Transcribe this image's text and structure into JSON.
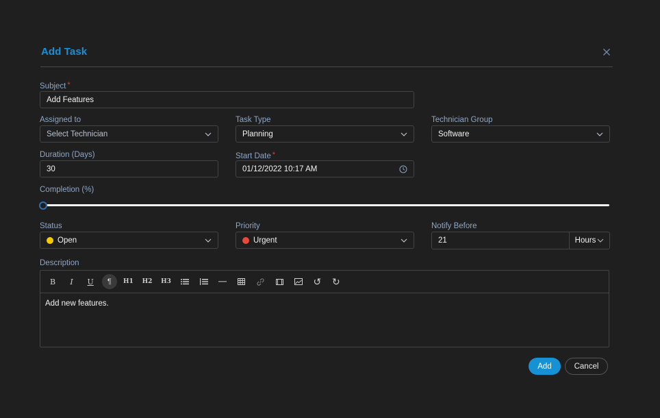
{
  "dialog": {
    "title": "Add Task",
    "close_icon": "close-icon"
  },
  "colors": {
    "accent": "#1591d4",
    "title": "#1a8fd6",
    "label": "#8ea6c6",
    "required": "#e0413a",
    "status_open": "#f5cc00",
    "priority_urgent": "#e8493b",
    "background": "#1f1f1f"
  },
  "fields": {
    "subject": {
      "label": "Subject",
      "required_mark": "*",
      "value": "Add Features"
    },
    "assigned_to": {
      "label": "Assigned to",
      "placeholder": "Select Technician"
    },
    "task_type": {
      "label": "Task Type",
      "value": "Planning"
    },
    "technician_group": {
      "label": "Technician Group",
      "value": "Software"
    },
    "duration": {
      "label": "Duration (Days)",
      "value": "30"
    },
    "start_date": {
      "label": "Start Date",
      "required_mark": "*",
      "value": "01/12/2022 10:17 AM",
      "icon": "clock-icon"
    },
    "completion": {
      "label": "Completion (%)",
      "value_percent": 0
    },
    "status": {
      "label": "Status",
      "value": "Open",
      "dot": "yellow"
    },
    "priority": {
      "label": "Priority",
      "value": "Urgent",
      "dot": "red"
    },
    "notify_before": {
      "label": "Notify Before",
      "value": "21",
      "unit": "Hours"
    },
    "description": {
      "label": "Description",
      "value": "Add new features.",
      "toolbar": [
        {
          "name": "bold",
          "glyph": "B"
        },
        {
          "name": "italic",
          "glyph": "I"
        },
        {
          "name": "underline",
          "glyph": "U"
        },
        {
          "name": "paragraph",
          "glyph": "¶",
          "active": true
        },
        {
          "name": "heading-1",
          "glyph": "H1"
        },
        {
          "name": "heading-2",
          "glyph": "H2"
        },
        {
          "name": "heading-3",
          "glyph": "H3"
        },
        {
          "name": "bullet-list",
          "glyph": ""
        },
        {
          "name": "ordered-list",
          "glyph": ""
        },
        {
          "name": "horizontal-rule",
          "glyph": ""
        },
        {
          "name": "table",
          "glyph": ""
        },
        {
          "name": "link",
          "glyph": ""
        },
        {
          "name": "video",
          "glyph": ""
        },
        {
          "name": "image",
          "glyph": ""
        },
        {
          "name": "undo",
          "glyph": "↺"
        },
        {
          "name": "redo",
          "glyph": "↻"
        }
      ]
    }
  },
  "actions": {
    "add_label": "Add",
    "cancel_label": "Cancel"
  }
}
